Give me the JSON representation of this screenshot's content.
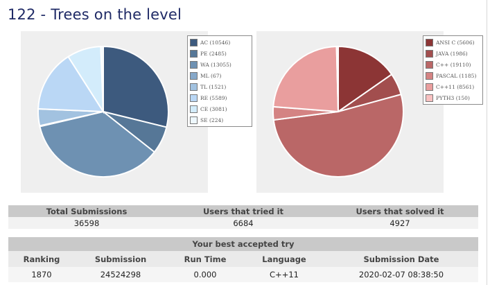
{
  "page": {
    "title": "122 - Trees on the level"
  },
  "colors": {
    "title": "#1f2a66",
    "header_bg": "#c9c9c9"
  },
  "chart_data": [
    {
      "type": "pie",
      "title": "",
      "legend_position": "right",
      "slices": [
        {
          "label": "AC (10546)",
          "value": 10546,
          "color": "#3d5a7e"
        },
        {
          "label": "PE (2485)",
          "value": 2485,
          "color": "#567797"
        },
        {
          "label": "WA (13055)",
          "value": 13055,
          "color": "#6e91b2"
        },
        {
          "label": "ML (67)",
          "value": 67,
          "color": "#86a8c9"
        },
        {
          "label": "TL (1521)",
          "value": 1521,
          "color": "#a2c2e0"
        },
        {
          "label": "RE (5589)",
          "value": 5589,
          "color": "#bad7f5"
        },
        {
          "label": "CE (3081)",
          "value": 3081,
          "color": "#d3ecfb"
        },
        {
          "label": "SE (224)",
          "value": 224,
          "color": "#eef8fe"
        }
      ]
    },
    {
      "type": "pie",
      "title": "",
      "legend_position": "right",
      "slices": [
        {
          "label": "ANSI C (5606)",
          "value": 5606,
          "color": "#8c3535"
        },
        {
          "label": "JAVA (1986)",
          "value": 1986,
          "color": "#a24e4e"
        },
        {
          "label": "C++ (19110)",
          "value": 19110,
          "color": "#ba6767"
        },
        {
          "label": "PASCAL (1185)",
          "value": 1185,
          "color": "#d48383"
        },
        {
          "label": "C++11 (8561)",
          "value": 8561,
          "color": "#e99e9e"
        },
        {
          "label": "PYTH3 (150)",
          "value": 150,
          "color": "#f8c1c1"
        }
      ]
    }
  ],
  "summary": {
    "headers": [
      "Total Submissions",
      "Users that tried it",
      "Users that solved it"
    ],
    "values": [
      "36598",
      "6684",
      "4927"
    ]
  },
  "best_try": {
    "caption": "Your best accepted try",
    "headers": [
      "Ranking",
      "Submission",
      "Run Time",
      "Language",
      "Submission Date"
    ],
    "values": [
      "1870",
      "24524298",
      "0.000",
      "C++11",
      "2020-02-07 08:38:50"
    ]
  }
}
